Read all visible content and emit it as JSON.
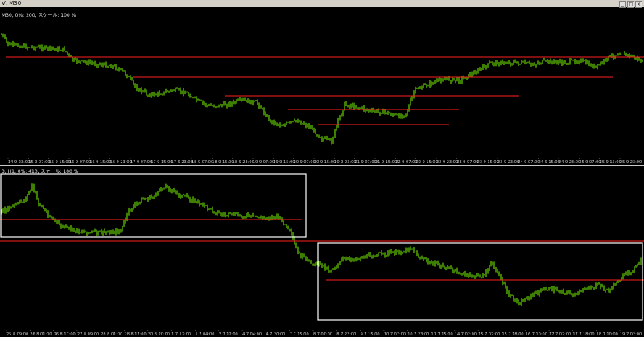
{
  "top_window": {
    "title": "V, M30",
    "label": "M30, 0%: 200, スケール: 100 %",
    "x_ticks": [
      "14 9 23:00",
      "15 9 07:00",
      "15 9 15:00",
      "16 9 07:00",
      "16 9 15:00",
      "16 9 23:00",
      "17 9 07:00",
      "17 9 15:00",
      "17 9 23:00",
      "18 9 07:00",
      "18 9 15:00",
      "18 9 23:00",
      "19 9 07:00",
      "19 9 15:00",
      "20 9 07:00",
      "20 9 15:00",
      "20 9 23:00",
      "21 9 07:00",
      "21 9 15:00",
      "22 9 07:00",
      "22 9 15:00",
      "22 9 23:00",
      "23 9 07:00",
      "23 9 15:00",
      "23 9 23:00",
      "24 9 07:00",
      "24 9 15:00",
      "24 9 23:00",
      "25 9 07:00",
      "25 9 15:00",
      "25 9 23:00"
    ]
  },
  "bottom_window": {
    "label": "3, H1, 0%: 410, スケール: 100 %",
    "x_ticks": [
      "25 8 09:00",
      "26 8 01:00",
      "26 8 17:00",
      "27 8 09:00",
      "28 8 01:00",
      "28 8 17:00",
      "30 8 20:00",
      "1 7 12:00",
      "1 7 04:00",
      "3 7 12:00",
      "4 7 04:00",
      "4 7 20:00",
      "7 7 15:00",
      "8 7 07:00",
      "8 7 23:00",
      "9 7 15:00",
      "10 7 07:00",
      "10 7 23:00",
      "11 7 15:00",
      "14 7 02:00",
      "15 7 02:00",
      "15 7 18:00",
      "16 7 10:00",
      "17 7 02:00",
      "17 7 18:00",
      "18 7 10:00",
      "19 7 02:00"
    ]
  },
  "colors": {
    "candle": "#7CFC00",
    "level_line": "#ff2020",
    "box": "#ffffff"
  }
}
